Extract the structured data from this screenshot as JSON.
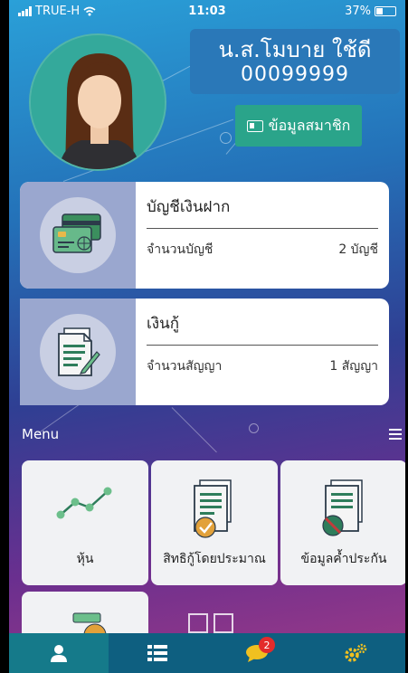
{
  "status_bar": {
    "carrier": "TRUE-H",
    "time": "11:03",
    "battery_percent": "37%",
    "battery_level": 0.37
  },
  "profile": {
    "name": "น.ส.โมบาย ใช้ดี",
    "member_id": "00099999",
    "member_info_button": "ข้อมูลสมาชิก"
  },
  "deposit_card": {
    "title": "บัญชีเงินฝาก",
    "row_label": "จำนวนบัญชี",
    "row_value": "2 บัญชี"
  },
  "loan_card": {
    "title": "เงินกู้",
    "row_label": "จำนวนสัญญา",
    "row_value": "1 สัญญา"
  },
  "menu": {
    "label": "Menu",
    "tiles": [
      {
        "label": "หุ้น",
        "icon": "stock-chart-icon"
      },
      {
        "label": "สิทธิกู้โดยประมาณ",
        "icon": "loan-estimate-icon"
      },
      {
        "label": "ข้อมูลค้ำประกัน",
        "icon": "guarantee-icon"
      }
    ]
  },
  "bottom_nav": {
    "items": [
      {
        "icon": "user-icon",
        "active": true
      },
      {
        "icon": "list-icon",
        "active": false
      },
      {
        "icon": "chat-icon",
        "active": false,
        "badge": "2"
      },
      {
        "icon": "settings-icon",
        "active": false
      }
    ]
  },
  "colors": {
    "accent_green": "#2aa48a",
    "name_box": "#2a78b8",
    "nav_bg": "#0e5f80",
    "badge_red": "#e32b2b"
  }
}
